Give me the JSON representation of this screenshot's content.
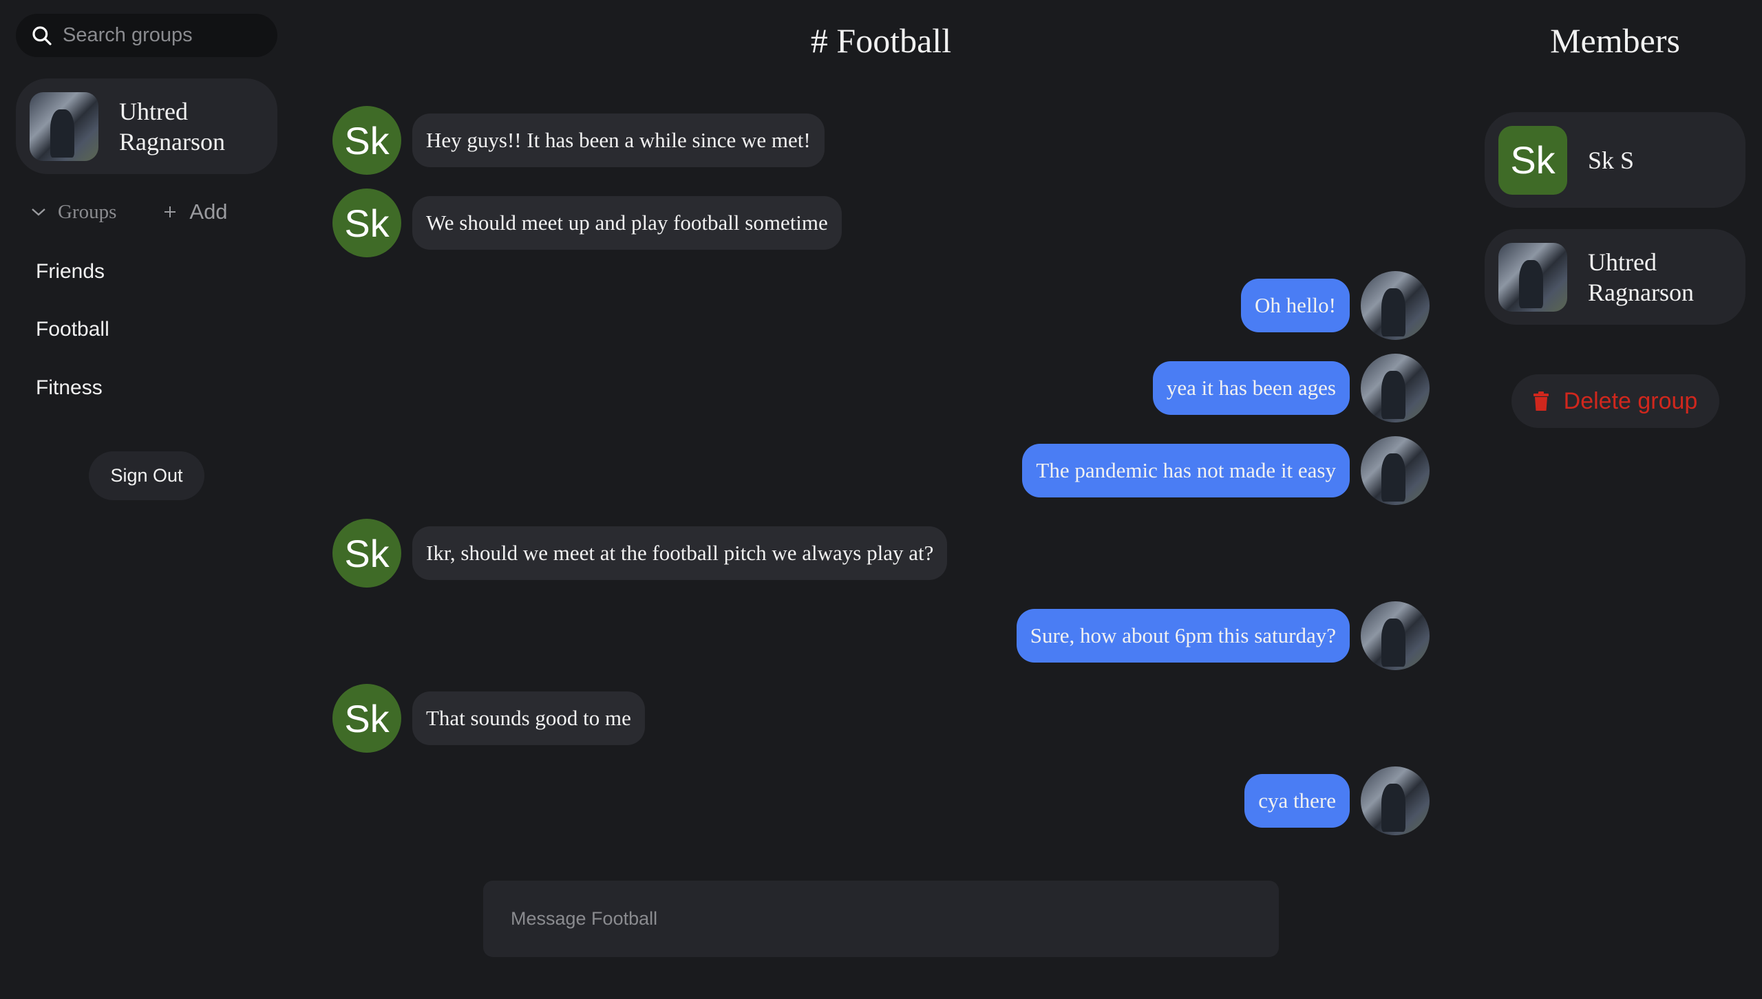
{
  "sidebar": {
    "search_placeholder": "Search groups",
    "user": {
      "name_line1": "Uhtred",
      "name_line2": "Ragnarson"
    },
    "groups_label": "Groups",
    "add_label": "Add",
    "groups": [
      "Friends",
      "Football",
      "Fitness"
    ],
    "sign_out": "Sign Out"
  },
  "chat": {
    "title": "# Football",
    "messages": [
      {
        "side": "left",
        "avatar": "Sk",
        "text": "Hey guys!! It has been a while since we met!"
      },
      {
        "side": "left",
        "avatar": "Sk",
        "text": "We should meet up and play football sometime"
      },
      {
        "side": "right",
        "text": "Oh hello!"
      },
      {
        "side": "right",
        "text": "yea it has been ages"
      },
      {
        "side": "right",
        "text": "The pandemic has not made it easy"
      },
      {
        "side": "left",
        "avatar": "Sk",
        "text": "Ikr, should we meet at the football pitch we always play at?"
      },
      {
        "side": "right",
        "text": "Sure, how about 6pm this saturday?"
      },
      {
        "side": "left",
        "avatar": "Sk",
        "text": "That sounds good to me"
      },
      {
        "side": "right",
        "text": "cya there"
      }
    ],
    "composer_placeholder": "Message Football"
  },
  "members": {
    "title": "Members",
    "list": [
      {
        "initials": "Sk",
        "name_line1": "Sk S",
        "name_line2": ""
      },
      {
        "name_line1": "Uhtred",
        "name_line2": "Ragnarson"
      }
    ],
    "delete_label": "Delete group"
  },
  "colors": {
    "accent": "#4a7df4",
    "avatar_green": "#3f6b27",
    "danger": "#d0271d",
    "card": "#25262b",
    "background": "#1a1b1e"
  }
}
